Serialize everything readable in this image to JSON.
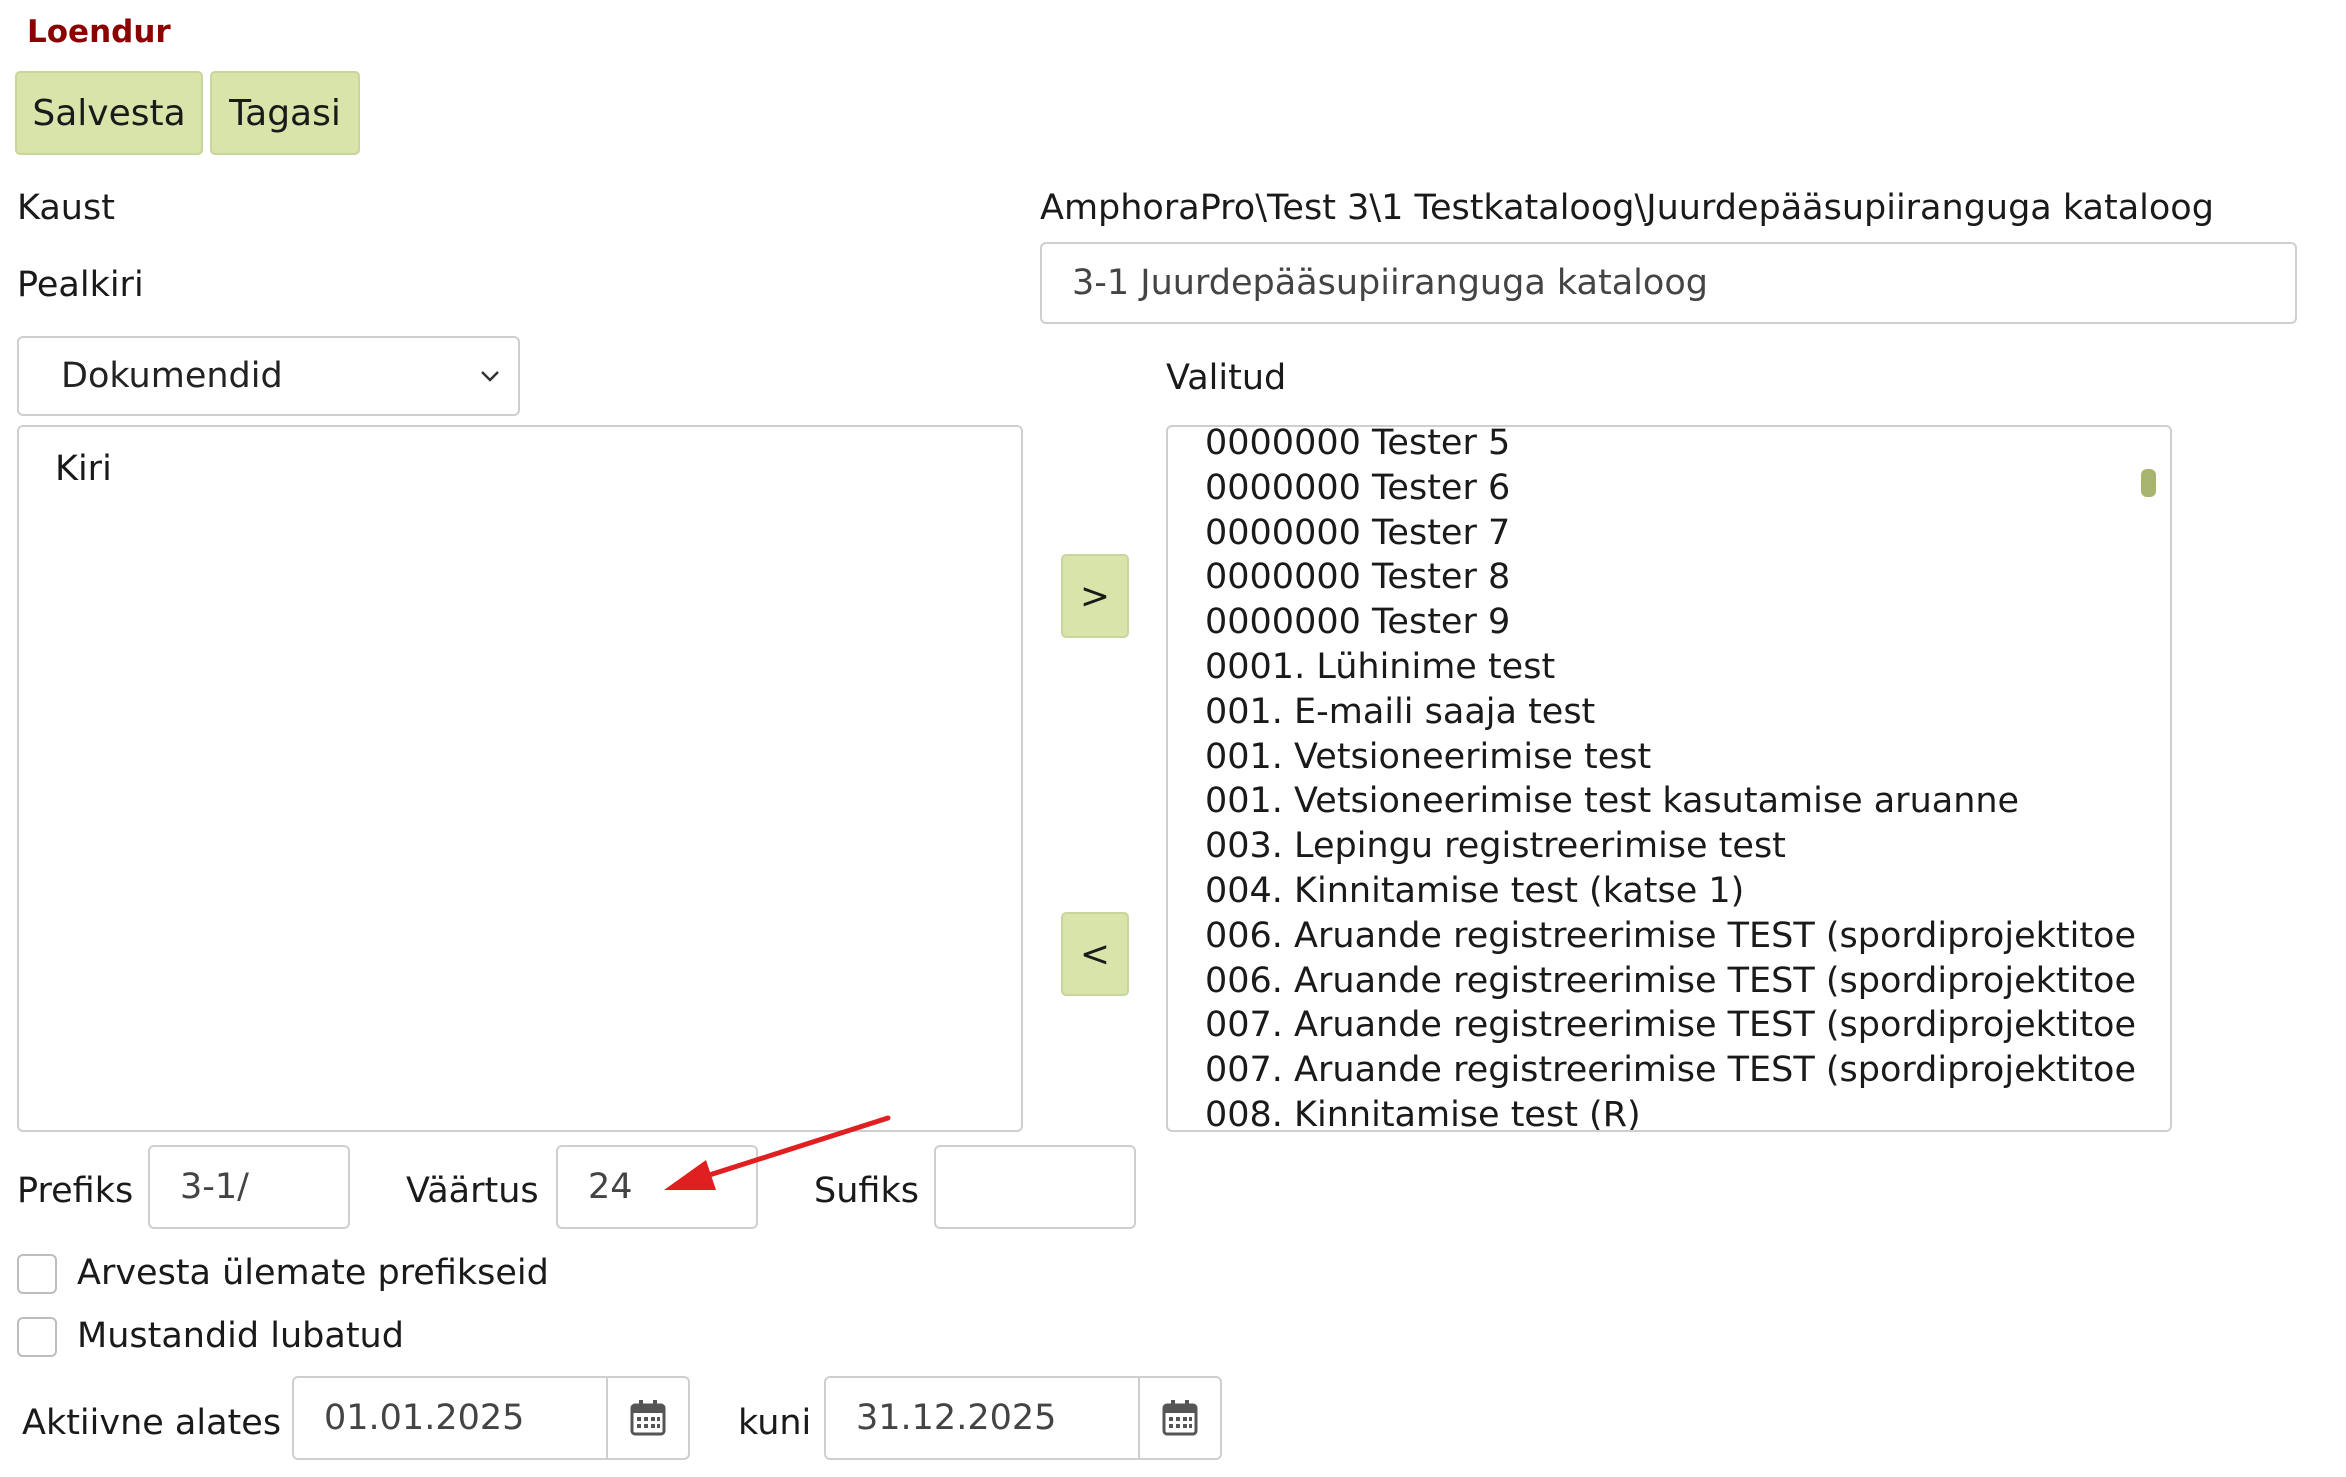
{
  "page": {
    "title": "Loendur"
  },
  "toolbar": {
    "save_label": "Salvesta",
    "back_label": "Tagasi"
  },
  "form": {
    "folder_label": "Kaust",
    "folder_value": "AmphoraPro\\Test 3\\1 Testkataloog\\Juurdepääsupiiranguga kataloog",
    "heading_label": "Pealkiri",
    "heading_value": "3-1 Juurdepääsupiiranguga kataloog",
    "type_select": {
      "selected": "Dokumendid"
    },
    "available_items": [
      "Kiri"
    ],
    "selected_label": "Valitud",
    "selected_items": [
      "0000000 Tester 5",
      "0000000 Tester 6",
      "0000000 Tester 7",
      "0000000 Tester 8",
      "0000000 Tester 9",
      "0001. Lühinime test",
      "001. E-maili saaja test",
      "001. Vetsioneerimise test",
      "001. Vetsioneerimise test kasutamise aruanne",
      "003. Lepingu registreerimise test",
      "004. Kinnitamise test (katse 1)",
      "006. Aruande registreerimise TEST (spordiprojektitoe",
      "006. Aruande registreerimise TEST (spordiprojektitoe",
      "007. Aruande registreerimise TEST (spordiprojektitoe",
      "007. Aruande registreerimise TEST (spordiprojektitoe",
      "008. Kinnitamise test (R)"
    ],
    "add_label": ">",
    "remove_label": "<",
    "prefix_label": "Prefiks",
    "prefix_value": "3-1/",
    "value_label": "Väärtus",
    "value_value": "24",
    "suffix_label": "Sufiks",
    "suffix_value": "",
    "include_parent_prefixes_label": "Arvesta ülemate prefikseid",
    "drafts_allowed_label": "Mustandid lubatud",
    "active_from_label": "Aktiivne alates",
    "active_from_value": "01.01.2025",
    "until_label": "kuni",
    "until_value": "31.12.2025"
  },
  "colors": {
    "title": "#8b0000",
    "button_bg": "#d8e4aa",
    "annotation_arrow": "#e02020"
  }
}
